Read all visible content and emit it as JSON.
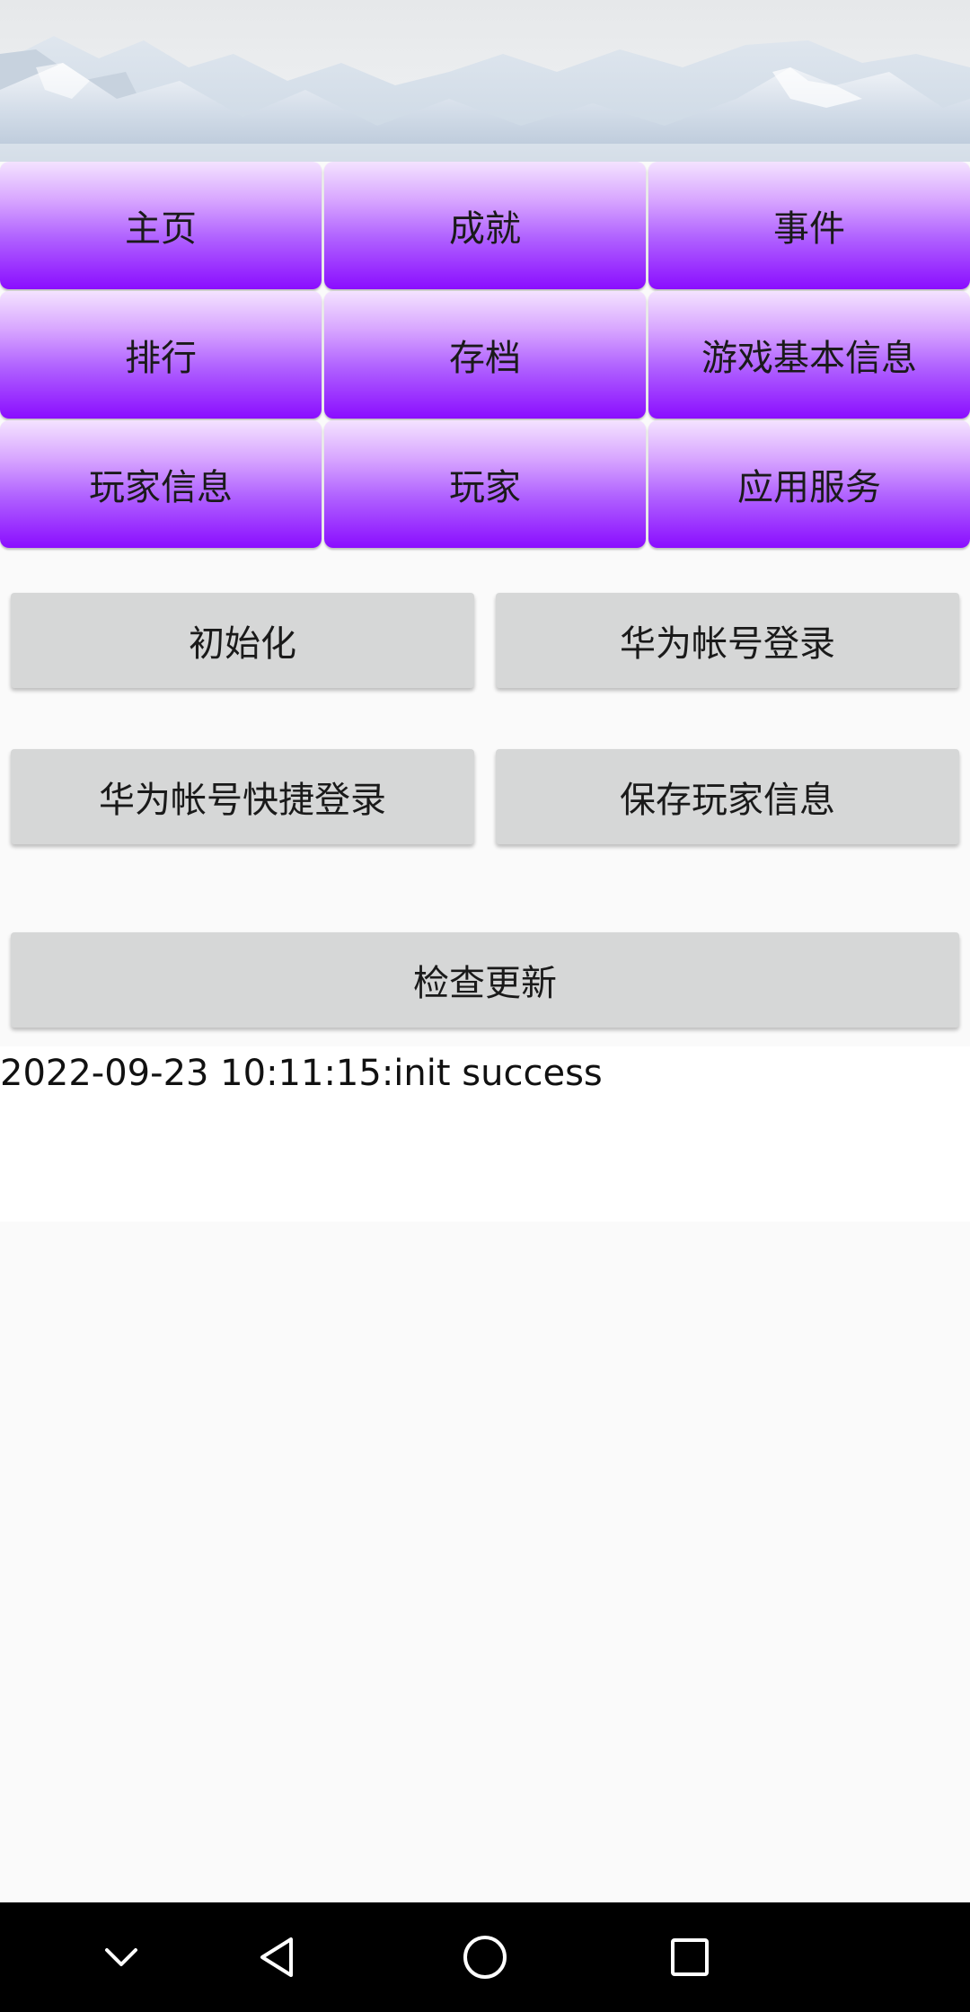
{
  "tabs": [
    {
      "label": "主页"
    },
    {
      "label": "成就"
    },
    {
      "label": "事件"
    },
    {
      "label": "排行"
    },
    {
      "label": "存档"
    },
    {
      "label": "游戏基本信息"
    },
    {
      "label": "玩家信息"
    },
    {
      "label": "玩家"
    },
    {
      "label": "应用服务"
    }
  ],
  "actions": {
    "init_label": "初始化",
    "huawei_login_label": "华为帐号登录",
    "huawei_quick_login_label": "华为帐号快捷登录",
    "save_player_info_label": "保存玩家信息",
    "check_update_label": "检查更新"
  },
  "log": {
    "text": "2022-09-23 10:11:15:init success"
  },
  "colors": {
    "tab_gradient_top": "#f4e3ff",
    "tab_gradient_bottom": "#8a0dff",
    "gray_button": "#d6d7d7",
    "navbar": "#000000"
  },
  "navbar": {
    "icons": [
      "chevron-down-icon",
      "back-triangle-icon",
      "home-circle-icon",
      "recents-square-icon"
    ]
  }
}
